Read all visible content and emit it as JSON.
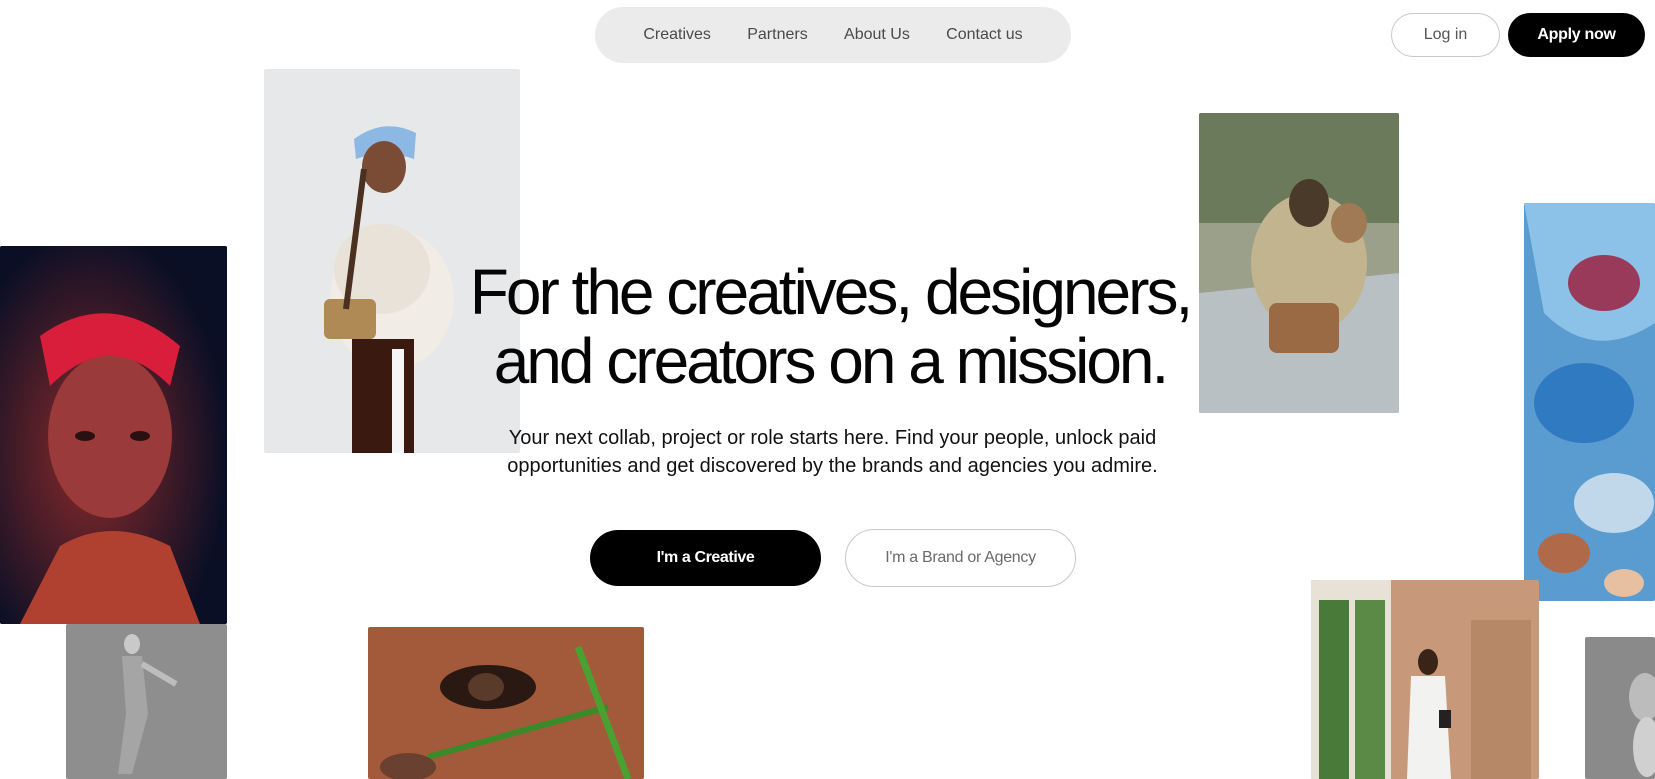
{
  "nav": {
    "items": [
      {
        "label": "Creatives"
      },
      {
        "label": "Partners"
      },
      {
        "label": "About Us"
      },
      {
        "label": "Contact us"
      }
    ],
    "login_label": "Log in",
    "apply_label": "Apply now"
  },
  "hero": {
    "title_line1": "For the creatives, designers,",
    "title_line2": "and creators on a mission.",
    "subtitle_line1": "Your next collab, project or role starts here. Find your people, unlock paid",
    "subtitle_line2": "opportunities and get discovered by the brands and agencies you admire.",
    "cta_creative": "I'm a Creative",
    "cta_brand": "I'm a Brand or Agency"
  },
  "colors": {
    "accent": "#000000",
    "nav_background": "#ebebeb",
    "background": "#ffffff"
  },
  "photos": [
    {
      "name": "woman-blue-cap-fur-jacket"
    },
    {
      "name": "portrait-red-braids"
    },
    {
      "name": "dancer-grey"
    },
    {
      "name": "eye-closeup-grass"
    },
    {
      "name": "couple-in-convertible"
    },
    {
      "name": "blue-abstract-paint"
    },
    {
      "name": "woman-by-window"
    },
    {
      "name": "grey-figure-partial"
    }
  ]
}
